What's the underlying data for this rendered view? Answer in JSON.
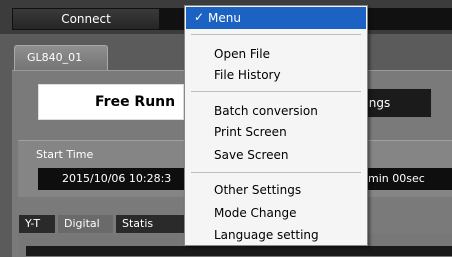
{
  "toolbar": {
    "connect_label": "Connect"
  },
  "device_tab": {
    "label": "GL840_01"
  },
  "status": {
    "text": "Free Runn",
    "settings_label": "Settings"
  },
  "start_time": {
    "label": "Start Time",
    "value": "2015/10/06 10:28:3",
    "elapsed": "min 00sec"
  },
  "tabs": [
    {
      "label": "Y-T"
    },
    {
      "label": "Digital"
    },
    {
      "label": "Statis"
    }
  ],
  "menu": {
    "header": "Menu",
    "check_icon": "✓",
    "groups": [
      [
        "Open File",
        "File History"
      ],
      [
        "Batch conversion",
        "Print Screen",
        "Save Screen"
      ],
      [
        "Other Settings",
        "Mode Change",
        "Language setting"
      ]
    ]
  }
}
